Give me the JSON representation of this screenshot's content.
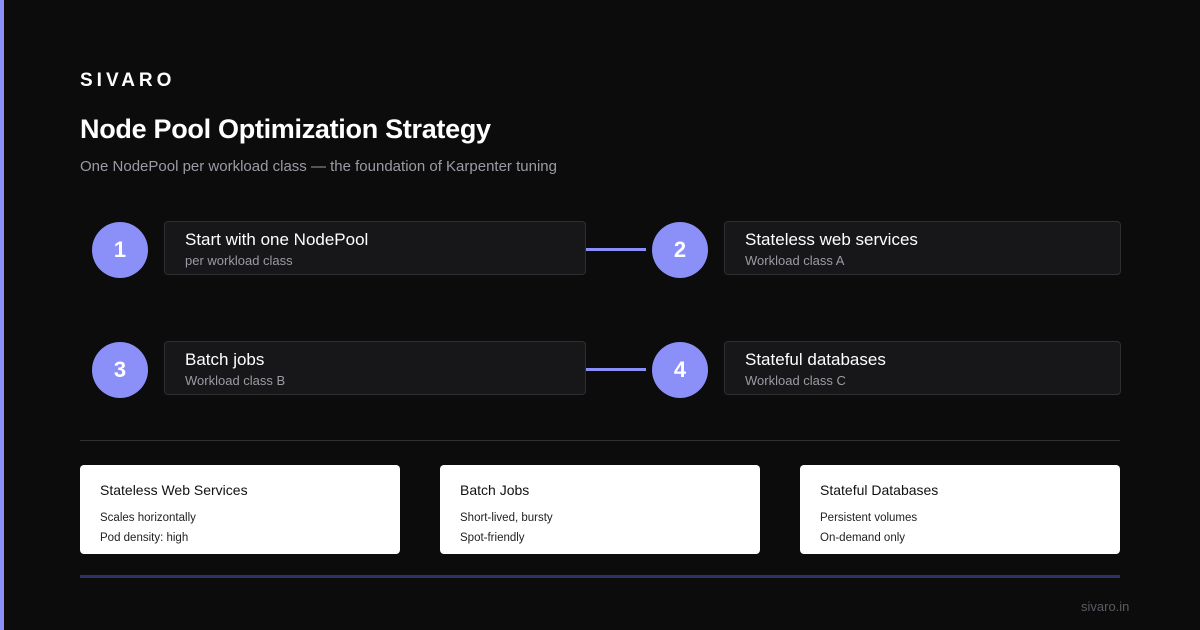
{
  "brand": "SIVARO",
  "title": "Node Pool Optimization Strategy",
  "subtitle": "One NodePool per workload class — the foundation of Karpenter tuning",
  "steps": [
    {
      "number": "1",
      "title": "Start with one NodePool",
      "desc": "per workload class"
    },
    {
      "number": "2",
      "title": "Stateless web services",
      "desc": "Workload class A"
    },
    {
      "number": "3",
      "title": "Batch jobs",
      "desc": "Workload class B"
    },
    {
      "number": "4",
      "title": "Stateful databases",
      "desc": "Workload class C"
    }
  ],
  "cards": [
    {
      "title": "Stateless Web Services",
      "lines": [
        "Scales horizontally",
        "Pod density: high"
      ]
    },
    {
      "title": "Batch Jobs",
      "lines": [
        "Short-lived, bursty",
        "Spot-friendly"
      ]
    },
    {
      "title": "Stateful Databases",
      "lines": [
        "Persistent volumes",
        "On-demand only"
      ]
    }
  ],
  "footer": "sivaro.in",
  "colors": {
    "accent": "#8b8ff8",
    "background": "#0c0c0d",
    "card": "#17171a",
    "info_card": "#ffffff"
  }
}
